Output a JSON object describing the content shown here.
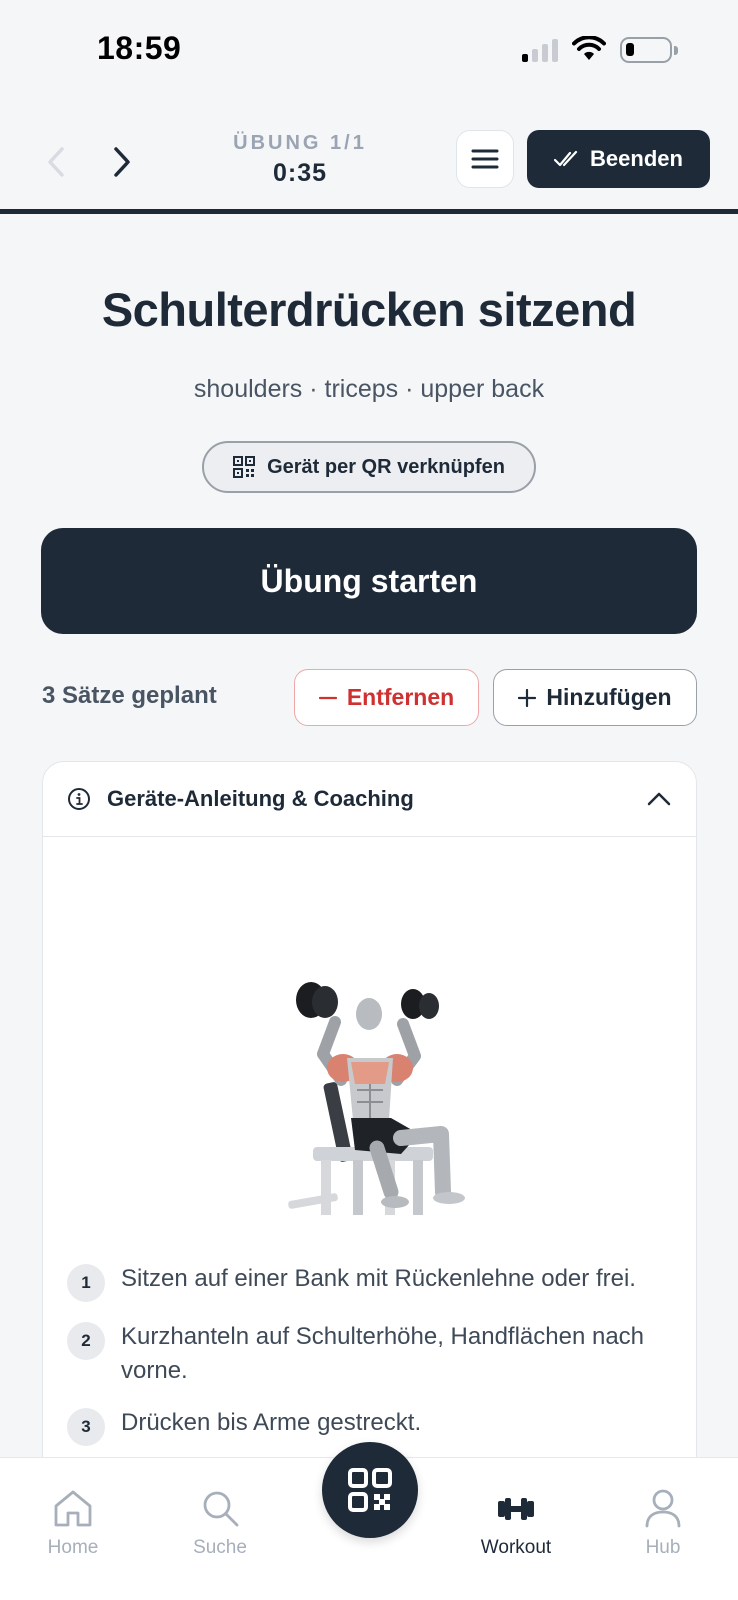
{
  "status_bar": {
    "time": "18:59"
  },
  "topnav": {
    "counter_label": "ÜBUNG 1/1",
    "counter_time": "0:35",
    "finish_label": "Beenden"
  },
  "exercise": {
    "title": "Schulterdrücken sitzend",
    "muscles": "shoulders · triceps · upper back",
    "qr_link_label": "Gerät per QR verknüpfen",
    "start_label": "Übung starten"
  },
  "sets": {
    "planned_label": "3 Sätze geplant",
    "remove_label": "Entfernen",
    "add_label": "Hinzufügen"
  },
  "coaching": {
    "title": "Geräte-Anleitung & Coaching",
    "steps": [
      {
        "num": "1",
        "text": "Sitzen auf einer Bank mit Rückenlehne oder frei."
      },
      {
        "num": "2",
        "text": "Kurzhanteln auf Schulterhöhe, Handflächen nach vorne."
      },
      {
        "num": "3",
        "text": "Drücken bis Arme gestreckt."
      }
    ]
  },
  "tabbar": {
    "home": "Home",
    "search": "Suche",
    "workout": "Workout",
    "hub": "Hub"
  },
  "colors": {
    "primary": "#1e2a38",
    "danger": "#d03030",
    "muted": "#a7afbb",
    "background": "#f5f6f8"
  },
  "icons": [
    "signal-icon",
    "wifi-icon",
    "battery-icon",
    "chevron-left-icon",
    "chevron-right-icon",
    "menu-icon",
    "double-check-icon",
    "qr-icon",
    "minus-icon",
    "plus-icon",
    "info-icon",
    "chevron-up-icon",
    "home-icon",
    "search-icon",
    "dumbbell-icon",
    "user-icon"
  ]
}
